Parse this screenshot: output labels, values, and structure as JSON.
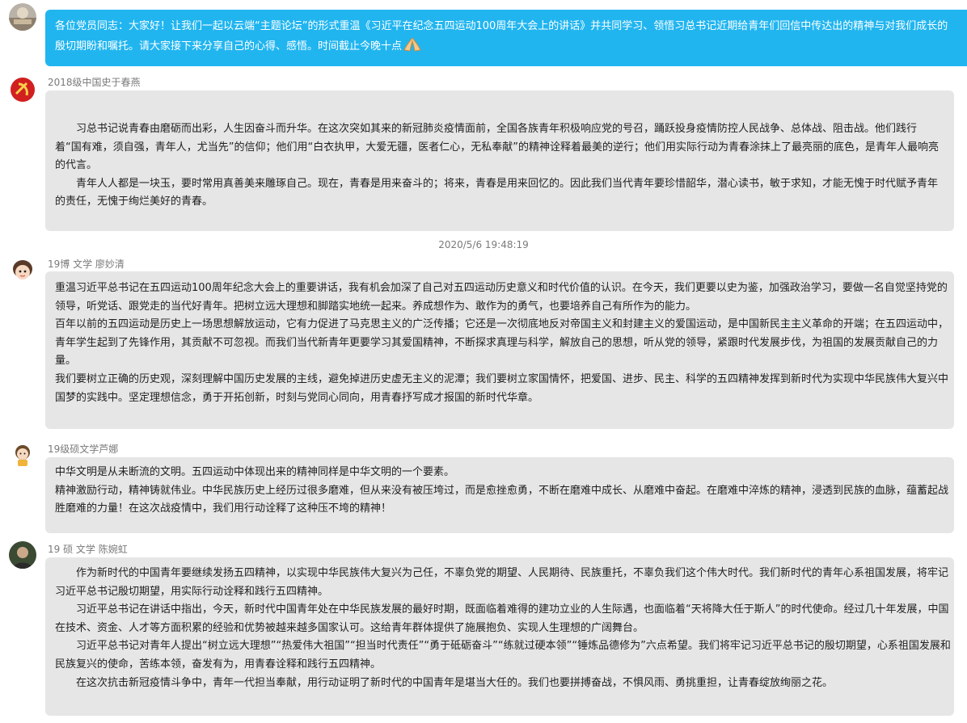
{
  "messages": [
    {
      "sender": "",
      "style": "blue",
      "paragraphs": [
        "各位党员同志：大家好！让我们一起以云端“主题论坛”的形式重温《习近平在纪念五四运动100周年大会上的讲话》并共同学习、领悟习总书记近期给青年们回信中传达出的精神与对我们成长的殷切期盼和嘱托。请大家接下来分享自己的心得、感悟。时间截止今晚十点"
      ],
      "emoji": "pray-icon"
    },
    {
      "sender": "2018级中国史于春燕",
      "paragraphs": [
        "习总书记说青春由磨砺而出彩，人生因奋斗而升华。在这次突如其来的新冠肺炎疫情面前，全国各族青年积极响应党的号召，踊跃投身疫情防控人民战争、总体战、阻击战。他们践行着“国有难，须自强，青年人，尤当先”的信仰；他们用“白衣执甲，大爱无疆，医者仁心，无私奉献”的精神诠释着最美的逆行；他们用实际行动为青春涂抹上了最亮丽的底色，是青年人最响亮的代言。",
        "青年人人都是一块玉，要时常用真善美来雕琢自己。现在，青春是用来奋斗的；将来，青春是用来回忆的。因此我们当代青年要珍惜韶华，潜心读书，敏于求知，才能无愧于时代赋予青年的责任，无愧于绚烂美好的青春。"
      ]
    },
    {
      "timestamp": "2020/5/6 19:48:19"
    },
    {
      "sender": "19博 文学 廖妙清",
      "paragraphs": [
        "重温习近平总书记在五四运动100周年纪念大会上的重要讲话，我有机会加深了自己对五四运动历史意义和时代价值的认识。在今天，我们更要以史为鉴，加强政治学习，要做一名自觉坚持党的领导，听党话、跟党走的当代好青年。把树立远大理想和脚踏实地统一起来。养成想作为、敢作为的勇气，也要培养自己有所作为的能力。",
        "百年以前的五四运动是历史上一场思想解放运动，它有力促进了马克思主义的广泛传播；它还是一次彻底地反对帝国主义和封建主义的爱国运动，是中国新民主主义革命的开端；在五四运动中，青年学生起到了先锋作用，其贡献不可忽视。而我们当代新青年更要学习其爱国精神，不断探求真理与科学，解放自己的思想，听从党的领导，紧跟时代发展步伐，为祖国的发展贡献自己的力量。",
        "我们要树立正确的历史观，深刻理解中国历史发展的主线，避免掉进历史虚无主义的泥潭；我们要树立家国情怀，把爱国、进步、民主、科学的五四精神发挥到新时代为实现中华民族伟大复兴中国梦的实践中。坚定理想信念，勇于开拓创新，时刻与党同心同向，用青春抒写成才报国的新时代华章。"
      ]
    },
    {
      "sender": "19级硕文学芦娜",
      "paragraphs": [
        "中华文明是从未断流的文明。五四运动中体现出来的精神同样是中华文明的一个要素。",
        "精神激励行动，精神铸就伟业。中华民族历史上经历过很多磨难，但从来没有被压垮过，而是愈挫愈勇，不断在磨难中成长、从磨难中奋起。在磨难中淬炼的精神，浸透到民族的血脉，蕴蓄起战胜磨难的力量！在这次战疫情中，我们用行动诠释了这种压不垮的精神！"
      ]
    },
    {
      "sender": "19 硕 文学 陈婉虹",
      "paragraphs": [
        "作为新时代的中国青年要继续发扬五四精神，以实现中华民族伟大复兴为己任，不辜负党的期望、人民期待、民族重托，不辜负我们这个伟大时代。我们新时代的青年心系祖国发展，将牢记习近平总书记殷切期望，用实际行动诠释和践行五四精神。",
        "习近平总书记在讲话中指出，今天，新时代中国青年处在中华民族发展的最好时期，既面临着难得的建功立业的人生际遇，也面临着“天将降大任于斯人”的时代使命。经过几十年发展，中国在技术、资金、人才等方面积累的经验和优势被越来越多国家认可。这给青年群体提供了施展抱负、实现人生理想的广阔舞台。",
        "习近平总书记对青年人提出“树立远大理想”“热爱伟大祖国”“担当时代责任”“勇于砥砺奋斗”“练就过硬本领”“锤炼品德修为”六点希望。我们将牢记习近平总书记的殷切期望，心系祖国发展和民族复兴的使命，苦练本领，奋发有为，用青春诠释和践行五四精神。",
        "在这次抗击新冠疫情斗争中，青年一代担当奉献，用行动证明了新时代的中国青年是堪当大任的。我们也要拼搏奋战，不惧风雨、勇挑重担，让青春绽放绚丽之花。"
      ]
    }
  ],
  "colors": {
    "blue_bubble": "#21b5f0",
    "gray_bubble": "#e6e6e6",
    "sender_text": "#7a7a7a"
  }
}
